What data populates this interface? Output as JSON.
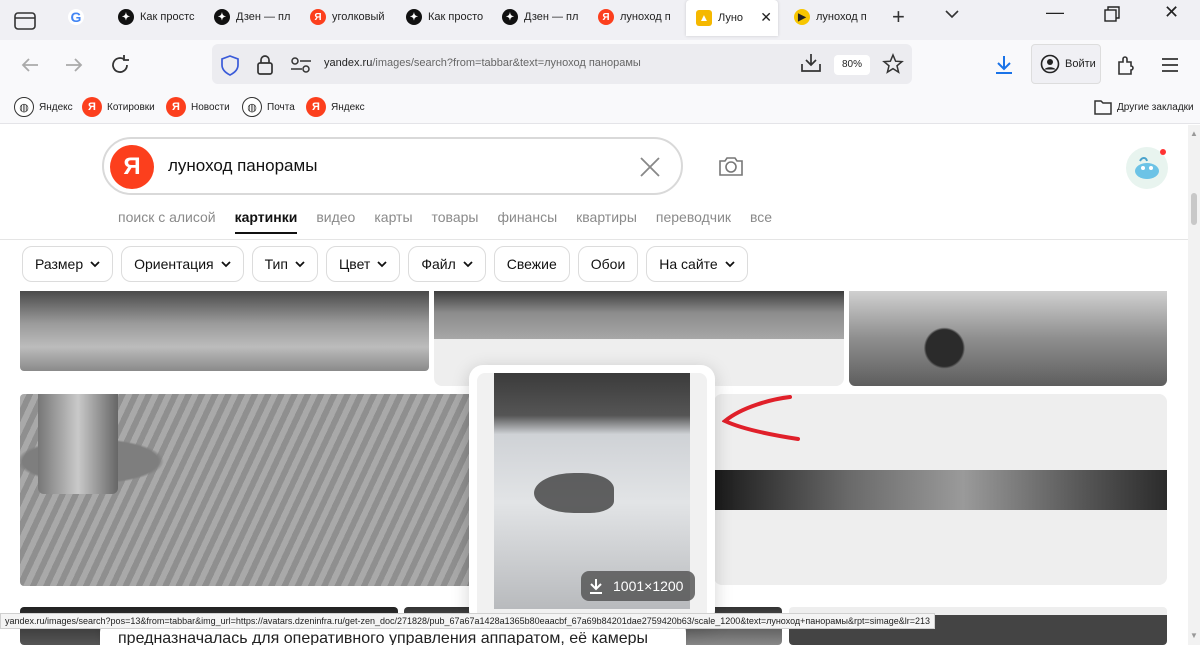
{
  "tabs": [
    {
      "label": "",
      "icon": "google-icon"
    },
    {
      "label": "Как простс",
      "icon": "dzen-icon"
    },
    {
      "label": "Дзен — пл",
      "icon": "dzen-icon"
    },
    {
      "label": "уголковый",
      "icon": "yandex-icon"
    },
    {
      "label": "Как просто",
      "icon": "dzen-icon"
    },
    {
      "label": "Дзен — пл",
      "icon": "dzen-icon"
    },
    {
      "label": "луноход п",
      "icon": "yandex-icon"
    },
    {
      "label": "Луно",
      "icon": "yandex-images-icon",
      "active": true
    },
    {
      "label": "луноход п",
      "icon": "yandex-video-icon"
    }
  ],
  "nav": {
    "url_host": "yandex.ru",
    "url_rest": "/images/search?from=tabbar&text=луноход панорамы",
    "zoom": "80%",
    "login_label": "Войти"
  },
  "bookmarks": [
    "Яндекс",
    "Котировки",
    "Новости",
    "Почта",
    "Яндекс"
  ],
  "bookmarks_other": "Другие закладки",
  "search": {
    "logo_letter": "Я",
    "query": "луноход панорамы"
  },
  "services": [
    "поиск с алисой",
    "картинки",
    "видео",
    "карты",
    "товары",
    "финансы",
    "квартиры",
    "переводчик",
    "все"
  ],
  "filters": [
    {
      "label": "Размер",
      "dropdown": true
    },
    {
      "label": "Ориентация",
      "dropdown": true
    },
    {
      "label": "Тип",
      "dropdown": true
    },
    {
      "label": "Цвет",
      "dropdown": true
    },
    {
      "label": "Файл",
      "dropdown": true
    },
    {
      "label": "Свежие",
      "dropdown": false
    },
    {
      "label": "Обои",
      "dropdown": false
    },
    {
      "label": "На сайте",
      "dropdown": true
    }
  ],
  "preview": {
    "size": "1001×1200"
  },
  "status_url": "yandex.ru/images/search?pos=13&from=tabbar&img_url=https://avatars.dzeninfra.ru/get-zen_doc/271828/pub_67a67a1428a1365b80eaacbf_67a69b84201dae2759420b63/scale_1200&text=луноход+панорамы&rpt=simage&lr=213",
  "bottom_text": "предназначалась для оперативного управления аппаратом, её камеры",
  "colors": {
    "yandex_red": "#fc3f1d",
    "annotation_arrow": "#e0202a"
  }
}
